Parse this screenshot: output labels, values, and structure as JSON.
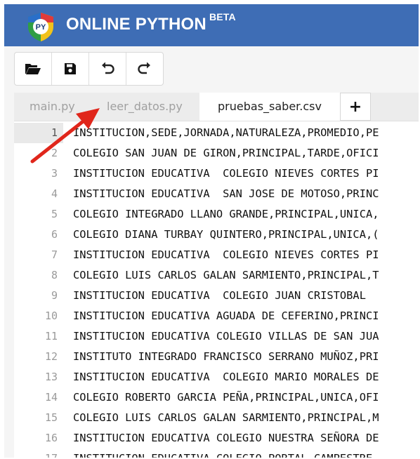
{
  "header": {
    "logo_text": "PY",
    "app_name": "ONLINE PYTHON",
    "badge": "BETA"
  },
  "toolbar": {
    "buttons": [
      {
        "icon": "open-folder-icon",
        "label": ""
      },
      {
        "icon": "save-icon",
        "label": ""
      },
      {
        "icon": "undo-icon",
        "label": ""
      },
      {
        "icon": "redo-icon",
        "label": ""
      }
    ]
  },
  "tabs": [
    {
      "label": "main.py",
      "active": false
    },
    {
      "label": "leer_datos.py",
      "active": false
    },
    {
      "label": "pruebas_saber.csv",
      "active": true
    }
  ],
  "add_tab_label": "+",
  "editor": {
    "lines": [
      {
        "num": "1",
        "text": "INSTITUCION,SEDE,JORNADA,NATURALEZA,PROMEDIO,PE"
      },
      {
        "num": "2",
        "text": "COLEGIO SAN JUAN DE GIRON,PRINCIPAL,TARDE,OFICI"
      },
      {
        "num": "3",
        "text": "INSTITUCION EDUCATIVA  COLEGIO NIEVES CORTES PI"
      },
      {
        "num": "4",
        "text": "INSTITUCION EDUCATIVA  SAN JOSE DE MOTOSO,PRINC"
      },
      {
        "num": "5",
        "text": "COLEGIO INTEGRADO LLANO GRANDE,PRINCIPAL,UNICA,"
      },
      {
        "num": "6",
        "text": "COLEGIO DIANA TURBAY QUINTERO,PRINCIPAL,UNICA,("
      },
      {
        "num": "7",
        "text": "INSTITUCION EDUCATIVA  COLEGIO NIEVES CORTES PI"
      },
      {
        "num": "8",
        "text": "COLEGIO LUIS CARLOS GALAN SARMIENTO,PRINCIPAL,T"
      },
      {
        "num": "9",
        "text": "INSTITUCION EDUCATIVA  COLEGIO JUAN CRISTOBAL"
      },
      {
        "num": "10",
        "text": "INSTITUCION EDUCATIVA AGUADA DE CEFERINO,PRINCI"
      },
      {
        "num": "11",
        "text": "INSTITUCION EDUCATIVA COLEGIO VILLAS DE SAN JUA"
      },
      {
        "num": "12",
        "text": "INSTITUTO INTEGRADO FRANCISCO SERRANO MUÑOZ,PRI"
      },
      {
        "num": "13",
        "text": "INSTITUCION EDUCATIVA  COLEGIO MARIO MORALES DE"
      },
      {
        "num": "14",
        "text": "COLEGIO ROBERTO GARCIA PEÑA,PRINCIPAL,UNICA,OFI"
      },
      {
        "num": "15",
        "text": "COLEGIO LUIS CARLOS GALAN SARMIENTO,PRINCIPAL,M"
      },
      {
        "num": "16",
        "text": "INSTITUCION EDUCATIVA COLEGIO NUESTRA SEÑORA DE"
      },
      {
        "num": "17",
        "text": "INSTITUCION EDUCATIVA COLEGIO PORTAL CAMPESTRE"
      }
    ]
  },
  "colors": {
    "header_bg": "#3e6db5",
    "arrow": "#e0261b"
  }
}
